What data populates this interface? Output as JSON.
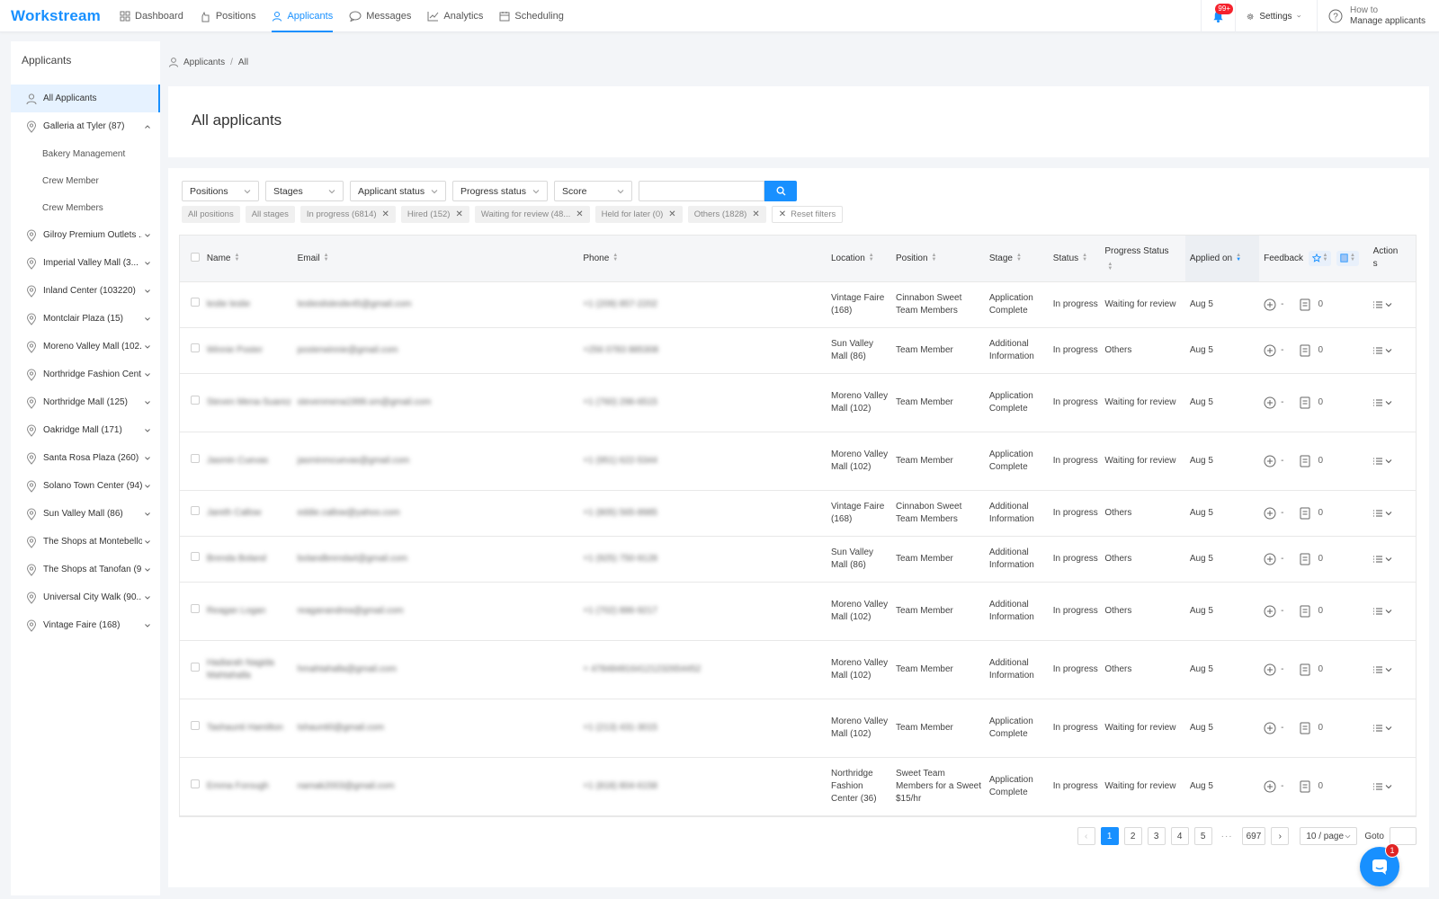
{
  "app": {
    "logo": "Workstream",
    "accent": "#1890ff"
  },
  "nav": {
    "items": [
      {
        "label": "Dashboard",
        "icon": "grid-icon"
      },
      {
        "label": "Positions",
        "icon": "hand-icon"
      },
      {
        "label": "Applicants",
        "icon": "user-icon",
        "active": true
      },
      {
        "label": "Messages",
        "icon": "chat-icon"
      },
      {
        "label": "Analytics",
        "icon": "chart-icon"
      },
      {
        "label": "Scheduling",
        "icon": "calendar-icon"
      }
    ],
    "notifications_badge": "99+",
    "settings_label": "Settings",
    "howto_line1": "How to",
    "howto_line2": "Manage applicants"
  },
  "sidebar": {
    "title": "Applicants",
    "all_label": "All Applicants",
    "galleria": "Galleria at Tyler (87)",
    "sub_items": [
      "Bakery Management",
      "Crew Member",
      "Crew Members"
    ],
    "locations": [
      "Gilroy Premium Outlets ...",
      "Imperial Valley Mall (3...",
      "Inland Center (103220)",
      "Montclair Plaza (15)",
      "Moreno Valley Mall (102...",
      "Northridge Fashion Cent...",
      "Northridge Mall (125)",
      "Oakridge Mall (171)",
      "Santa Rosa Plaza (260)",
      "Solano Town Center (94)",
      "Sun Valley Mall (86)",
      "The Shops at Montebello...",
      "The Shops at Tanofan (9...",
      "Universal City Walk (90...",
      "Vintage Faire (168)"
    ]
  },
  "breadcrumb": {
    "root": "Applicants",
    "sep": "/",
    "current": "All"
  },
  "page_title": "All applicants",
  "filters": {
    "positions": "Positions",
    "stages": "Stages",
    "applicant_status": "Applicant status",
    "progress_status": "Progress status",
    "score": "Score",
    "search_value": ""
  },
  "tags": {
    "all_positions": "All positions",
    "all_stages": "All stages",
    "in_progress": "In progress (6814)",
    "hired": "Hired (152)",
    "waiting": "Waiting for review (48...",
    "held": "Held for later (0)",
    "others": "Others (1828)",
    "reset": "Reset filters"
  },
  "table": {
    "headers": {
      "name": "Name",
      "email": "Email",
      "phone": "Phone",
      "location": "Location",
      "position": "Position",
      "stage": "Stage",
      "status": "Status",
      "progress": "Progress Status",
      "applied": "Applied on",
      "feedback": "Feedback",
      "actions": "Actions"
    },
    "rows": [
      {
        "name": "leslie leslie",
        "email": "leslieslisleslie45@gmail.com",
        "phone": "+1 (209) 857-2202",
        "location": "Vintage Faire (168)",
        "position": "Cinnabon Sweet Team Members",
        "stage": "Application Complete",
        "status": "In progress",
        "progress": "Waiting for review",
        "applied": "Aug 5",
        "feedback": "-",
        "notes": "0"
      },
      {
        "name": "Winnie Poster",
        "email": "posterwinnie@gmail.com",
        "phone": "+256 0783 885308",
        "location": "Sun Valley Mall (86)",
        "position": "Team Member",
        "stage": "Additional Information",
        "status": "In progress",
        "progress": "Others",
        "applied": "Aug 5",
        "feedback": "-",
        "notes": "0"
      },
      {
        "name": "Steven Mena-Suarez",
        "email": "stevenmena1999.sm@gmail.com",
        "phone": "+1 (760) 296-6515",
        "location": "Moreno Valley Mall (102)",
        "position": "Team Member",
        "stage": "Application Complete",
        "status": "In progress",
        "progress": "Waiting for review",
        "applied": "Aug 5",
        "feedback": "-",
        "notes": "0"
      },
      {
        "name": "Jasmin Cuevas",
        "email": "jasminmcuevas@gmail.com",
        "phone": "+1 (951) 622-5344",
        "location": "Moreno Valley Mall (102)",
        "position": "Team Member",
        "stage": "Application Complete",
        "status": "In progress",
        "progress": "Waiting for review",
        "applied": "Aug 5",
        "feedback": "-",
        "notes": "0"
      },
      {
        "name": "Jareth Callow",
        "email": "eddie.callow@yahoo.com",
        "phone": "+1 (805) 565-8985",
        "location": "Vintage Faire (168)",
        "position": "Cinnabon Sweet Team Members",
        "stage": "Additional Information",
        "status": "In progress",
        "progress": "Others",
        "applied": "Aug 5",
        "feedback": "-",
        "notes": "0"
      },
      {
        "name": "Brenda Boland",
        "email": "bolandbrenda4@gmail.com",
        "phone": "+1 (925) 750-9128",
        "location": "Sun Valley Mall (86)",
        "position": "Team Member",
        "stage": "Additional Information",
        "status": "In progress",
        "progress": "Others",
        "applied": "Aug 5",
        "feedback": "-",
        "notes": "0"
      },
      {
        "name": "Reagan Logan",
        "email": "reaganandrea@gmail.com",
        "phone": "+1 (702) 886-9217",
        "location": "Moreno Valley Mall (102)",
        "position": "Team Member",
        "stage": "Additional Information",
        "status": "In progress",
        "progress": "Others",
        "applied": "Aug 5",
        "feedback": "-",
        "notes": "0"
      },
      {
        "name": "Hadiarah Nagida Mahtahalla",
        "email": "hmahtahalla@gmail.com",
        "phone": "+ 4784848164121232654452",
        "location": "Moreno Valley Mall (102)",
        "position": "Team Member",
        "stage": "Additional Information",
        "status": "In progress",
        "progress": "Others",
        "applied": "Aug 5",
        "feedback": "-",
        "notes": "0"
      },
      {
        "name": "Tashaunti Hamilton",
        "email": "tshaunti0@gmail.com",
        "phone": "+1 (213) 431-3015",
        "location": "Moreno Valley Mall (102)",
        "position": "Team Member",
        "stage": "Application Complete",
        "status": "In progress",
        "progress": "Waiting for review",
        "applied": "Aug 5",
        "feedback": "-",
        "notes": "0"
      },
      {
        "name": "Emma Forough",
        "email": "namak2003@gmail.com",
        "phone": "+1 (818) 804-6158",
        "location": "Northridge Fashion Center (36)",
        "position": "Sweet Team Members for a Sweet $15/hr",
        "stage": "Application Complete",
        "status": "In progress",
        "progress": "Waiting for review",
        "applied": "Aug 5",
        "feedback": "-",
        "notes": "0"
      }
    ]
  },
  "pagination": {
    "pages": [
      "1",
      "2",
      "3",
      "4",
      "5"
    ],
    "ellipsis": "···",
    "last": "697",
    "page_size": "10 / page",
    "goto": "Goto"
  },
  "chat": {
    "badge": "1"
  }
}
